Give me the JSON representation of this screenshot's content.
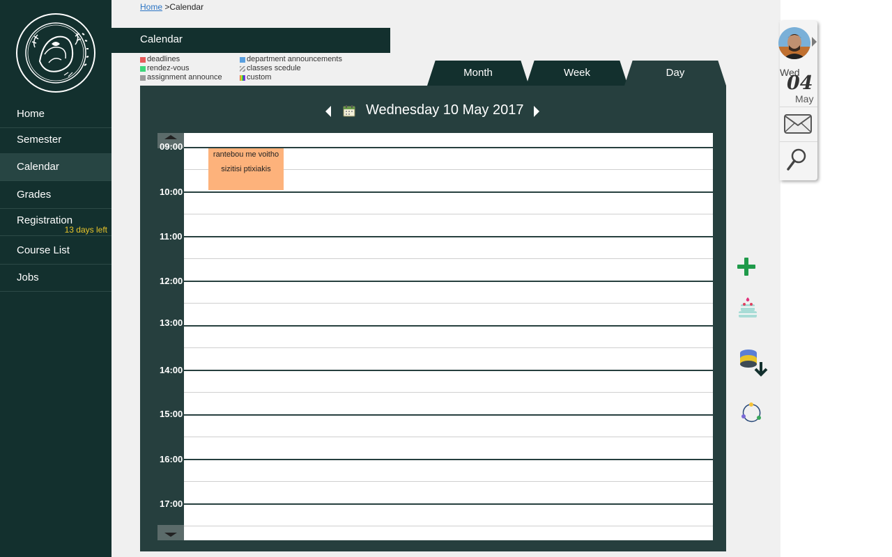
{
  "breadcrumb": {
    "home": "Home",
    "separator": ">",
    "current": "Calendar"
  },
  "page_title": "Calendar",
  "sidebar": {
    "items": [
      {
        "label": "Home"
      },
      {
        "label": "Semester"
      },
      {
        "label": "Calendar",
        "active": true
      },
      {
        "label": "Grades"
      },
      {
        "label": "Registration",
        "badge": "13 days left"
      },
      {
        "label": "Course List"
      },
      {
        "label": "Jobs"
      }
    ]
  },
  "legend": [
    {
      "label": "deadlines",
      "color": "#e65a5a"
    },
    {
      "label": "rendez-vous",
      "color": "#3dd67a"
    },
    {
      "label": "assignment announce",
      "color": "#9a9a9a"
    },
    {
      "label": "department announcements",
      "color": "#5aa0e0"
    },
    {
      "label": "classes scedule",
      "color": "striped"
    },
    {
      "label": "custom",
      "color": "rainbow"
    }
  ],
  "tabs": [
    {
      "label": "Month"
    },
    {
      "label": "Week"
    },
    {
      "label": "Day",
      "active": true
    }
  ],
  "calendar": {
    "date_label": "Wednesday 10 May 2017",
    "hours": [
      "09:00",
      "10:00",
      "11:00",
      "12:00",
      "13:00",
      "14:00",
      "15:00",
      "16:00",
      "17:00"
    ]
  },
  "event": {
    "title": "rantebou me voitho",
    "subtitle": "sizitisi ptixiakis",
    "color": "#fdb27b"
  },
  "today": {
    "weekday": "Wed",
    "day": "04",
    "month": "May"
  },
  "colors": {
    "sidebar": "#13302e",
    "panel": "#263f3e",
    "accent_badge": "#e8c42a"
  },
  "icons": [
    "envelope-icon",
    "search-icon",
    "add-icon",
    "birthday-cake-icon",
    "database-download-icon",
    "sync-circle-icon",
    "calendar-icon"
  ]
}
